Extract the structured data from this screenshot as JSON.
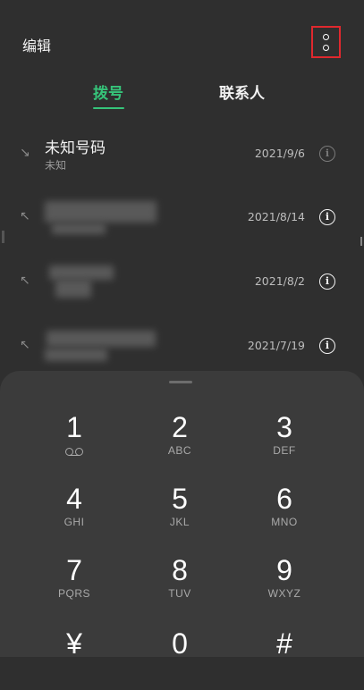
{
  "header": {
    "edit_label": "编辑",
    "menu_icon": "more-vertical-icon"
  },
  "tabs": [
    {
      "label": "拨号",
      "active": true
    },
    {
      "label": "联系人",
      "active": false
    }
  ],
  "accent_color": "#36c47a",
  "highlight_color": "#e0282e",
  "calls": [
    {
      "name": "未知号码",
      "sub": "未知",
      "date": "2021/9/6",
      "direction": "incoming"
    },
    {
      "name": "",
      "sub": "",
      "date": "2021/8/14",
      "direction": "outgoing"
    },
    {
      "name": "",
      "sub": "",
      "date": "2021/8/2",
      "direction": "outgoing"
    },
    {
      "name": "",
      "sub": "",
      "date": "2021/7/19",
      "direction": "outgoing"
    }
  ],
  "keypad": [
    {
      "digit": "1",
      "letters": ""
    },
    {
      "digit": "2",
      "letters": "ABC"
    },
    {
      "digit": "3",
      "letters": "DEF"
    },
    {
      "digit": "4",
      "letters": "GHI"
    },
    {
      "digit": "5",
      "letters": "JKL"
    },
    {
      "digit": "6",
      "letters": "MNO"
    },
    {
      "digit": "7",
      "letters": "PQRS"
    },
    {
      "digit": "8",
      "letters": "TUV"
    },
    {
      "digit": "9",
      "letters": "WXYZ"
    },
    {
      "digit": "¥",
      "letters": ""
    },
    {
      "digit": "0",
      "letters": ""
    },
    {
      "digit": "#",
      "letters": ""
    }
  ]
}
